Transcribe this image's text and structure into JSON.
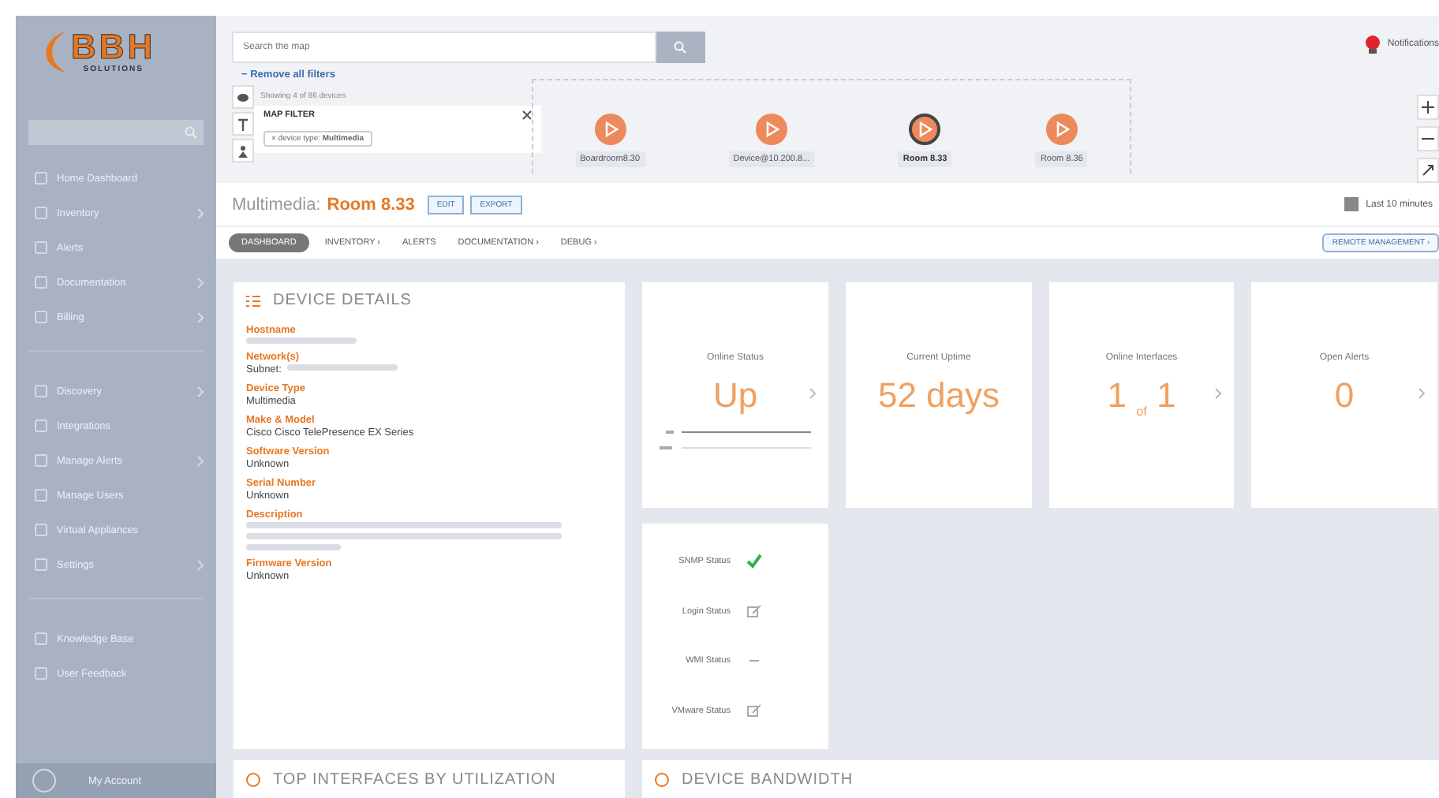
{
  "logo": {
    "name": "BBH",
    "tagline": "SOLUTIONS"
  },
  "sidebar": {
    "sections": [
      {
        "items": [
          {
            "label": "Home Dashboard",
            "has_submenu": false
          },
          {
            "label": "Inventory",
            "has_submenu": true
          },
          {
            "label": "Alerts",
            "has_submenu": false
          },
          {
            "label": "Documentation",
            "has_submenu": true
          },
          {
            "label": "Billing",
            "has_submenu": true
          }
        ]
      },
      {
        "items": [
          {
            "label": "Discovery",
            "has_submenu": true
          },
          {
            "label": "Integrations",
            "has_submenu": false
          },
          {
            "label": "Manage Alerts",
            "has_submenu": true
          },
          {
            "label": "Manage Users",
            "has_submenu": false
          },
          {
            "label": "Virtual Appliances",
            "has_submenu": false
          },
          {
            "label": "Settings",
            "has_submenu": true
          }
        ]
      },
      {
        "items": [
          {
            "label": "Knowledge Base",
            "has_submenu": false
          },
          {
            "label": "User Feedback",
            "has_submenu": false
          }
        ]
      }
    ],
    "account": "My Account"
  },
  "map": {
    "search_placeholder": "Search the map",
    "remove_filters": "− Remove all filters",
    "showing": "Showing 4 of 86 devices",
    "filter_title": "MAP FILTER",
    "filter_tag": "× device type: **Multimedia**",
    "nodes": [
      {
        "label": "Boardroom8.30",
        "selected": false
      },
      {
        "label": "Device@10.200.8...",
        "selected": false
      },
      {
        "label": "Room 8.33",
        "selected": true
      },
      {
        "label": "Room 8.36",
        "selected": false
      }
    ],
    "notifications": "Notifications"
  },
  "header": {
    "type": "Multimedia:",
    "name": "Room 8.33",
    "buttons": [
      "EDIT",
      "EXPORT"
    ],
    "time_range": "Last 10 minutes"
  },
  "tabs": [
    {
      "label": "DASHBOARD",
      "selected": true
    },
    {
      "label": "INVENTORY ›",
      "selected": false
    },
    {
      "label": "ALERTS",
      "selected": false
    },
    {
      "label": "DOCUMENTATION ›",
      "selected": false
    },
    {
      "label": "DEBUG ›",
      "selected": false
    }
  ],
  "remote_management": "REMOTE MANAGEMENT ›",
  "details": {
    "title": "DEVICE DETAILS",
    "fields": [
      {
        "label": "Hostname",
        "kind": "redacted"
      },
      {
        "label": "Network(s)",
        "value": "Subnet:",
        "kind": "mixed"
      },
      {
        "label": "Device Type",
        "value": "Multimedia",
        "kind": "text"
      },
      {
        "label": "Make & Model",
        "value": "Cisco Cisco TelePresence EX Series",
        "kind": "text"
      },
      {
        "label": "Software Version",
        "value": "Unknown",
        "kind": "text"
      },
      {
        "label": "Serial Number",
        "value": "Unknown",
        "kind": "text"
      },
      {
        "label": "Description",
        "kind": "redacted_block"
      },
      {
        "label": "Firmware Version",
        "value": "Unknown",
        "kind": "text"
      }
    ]
  },
  "stats": [
    {
      "title": "Online Status",
      "value": "Up",
      "kind": "status",
      "arrow": true
    },
    {
      "title": "Current Uptime",
      "value": "52 days",
      "kind": "plain",
      "arrow": false
    },
    {
      "title": "Online Interfaces",
      "value": "1 $_{of}$ 1",
      "kind": "plain",
      "arrow": true
    },
    {
      "title": "Open Alerts",
      "value": "0",
      "kind": "plain",
      "arrow": true
    }
  ],
  "status_list": [
    {
      "label": "SNMP Status",
      "kind": "ok"
    },
    {
      "label": "Login Status",
      "kind": "edit"
    },
    {
      "label": "WMI Status",
      "kind": "none"
    },
    {
      "label": "VMware Status",
      "kind": "edit"
    }
  ],
  "bottom_panels": [
    "TOP INTERFACES BY UTILIZATION",
    "DEVICE BANDWIDTH"
  ]
}
